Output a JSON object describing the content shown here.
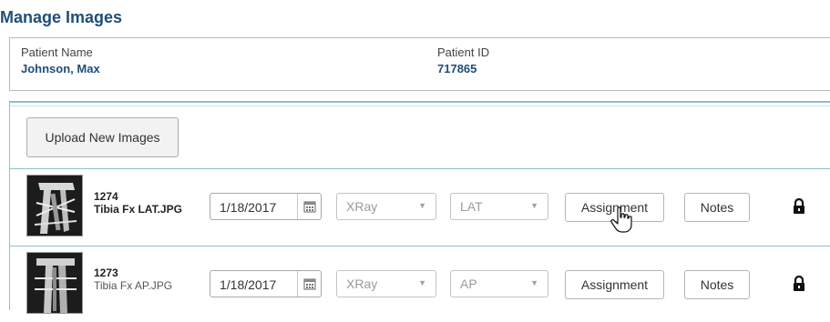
{
  "page": {
    "title": "Manage Images"
  },
  "patient": {
    "name_label": "Patient Name",
    "name_value": "Johnson, Max",
    "id_label": "Patient ID",
    "id_value": "717865"
  },
  "toolbar": {
    "upload_label": "Upload New Images"
  },
  "images": [
    {
      "id": "1274",
      "filename": "Tibia Fx LAT.JPG",
      "date": "1/18/2017",
      "type": "XRay",
      "view": "LAT",
      "assignment_label": "Assignment",
      "notes_label": "Notes",
      "locked": true
    },
    {
      "id": "1273",
      "filename": "Tibia Fx AP.JPG",
      "date": "1/18/2017",
      "type": "XRay",
      "view": "AP",
      "assignment_label": "Assignment",
      "notes_label": "Notes",
      "locked": true
    }
  ],
  "icons": {
    "calendar": "calendar-icon",
    "dropdown": "chevron-down-icon",
    "lock": "lock-icon",
    "cursor": "hand-pointer-icon"
  },
  "colors": {
    "title": "#1f4e79",
    "panel_border": "#8fbfd0",
    "button_bg": "#f2f2f2"
  }
}
